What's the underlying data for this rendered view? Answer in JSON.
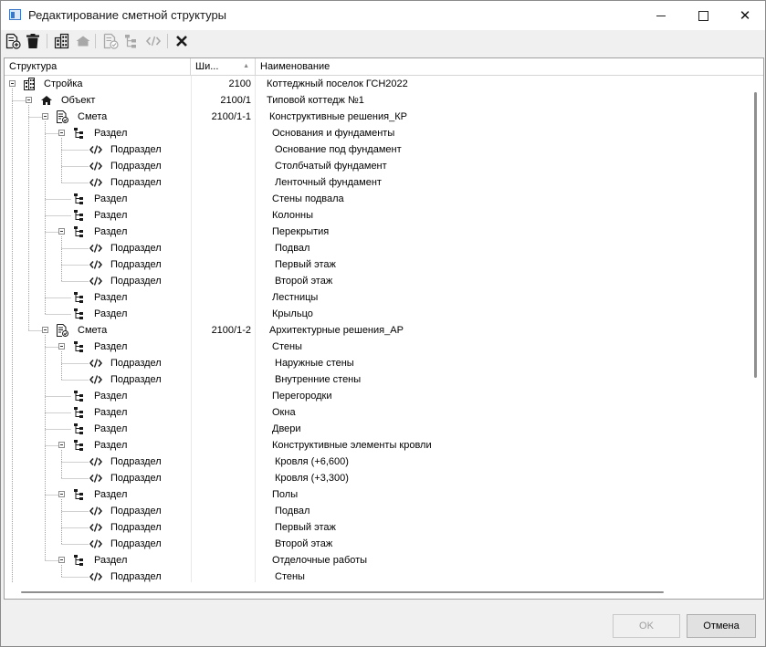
{
  "window": {
    "title": "Редактирование сметной структуры",
    "minimize_icon": "minimize-icon",
    "maximize_icon": "maximize-icon",
    "close_icon": "close-icon",
    "close_glyph": "✕"
  },
  "toolbar": {
    "buttons": [
      {
        "name": "add-item-button",
        "icon": "document-add-icon",
        "enabled": true
      },
      {
        "name": "delete-item-button",
        "icon": "trash-icon",
        "enabled": true
      },
      {
        "name": "add-construction-button",
        "icon": "building-icon",
        "enabled": true
      },
      {
        "name": "add-object-button",
        "icon": "house-icon",
        "enabled": false
      },
      {
        "name": "add-estimate-button",
        "icon": "estimate-icon",
        "enabled": false
      },
      {
        "name": "add-section-button",
        "icon": "section-tree-icon",
        "enabled": false
      },
      {
        "name": "add-subsection-button",
        "icon": "code-brackets-icon",
        "enabled": false
      },
      {
        "name": "cancel-x-button",
        "icon": "x-icon",
        "enabled": true
      }
    ]
  },
  "grid": {
    "columns": [
      {
        "label": "Структура"
      },
      {
        "label": "Ши..."
      },
      {
        "label": "Наименование"
      }
    ],
    "sort_glyph": "▲",
    "rows": [
      {
        "level": 0,
        "expander": true,
        "type": "construction",
        "label": "Стройка",
        "code": "2100",
        "name": "Коттеджный поселок ГСН2022"
      },
      {
        "level": 1,
        "expander": true,
        "type": "object",
        "label": "Объект",
        "code": "2100/1",
        "name": "Типовой коттедж №1"
      },
      {
        "level": 2,
        "expander": true,
        "type": "estimate",
        "label": "Смета",
        "code": "2100/1-1",
        "name": "Конструктивные решения_КР"
      },
      {
        "level": 3,
        "expander": true,
        "type": "section",
        "label": "Раздел",
        "code": "",
        "name": "Основания и фундаменты"
      },
      {
        "level": 4,
        "expander": false,
        "type": "subsection",
        "label": "Подраздел",
        "code": "",
        "name": "Основание под фундамент"
      },
      {
        "level": 4,
        "expander": false,
        "type": "subsection",
        "label": "Подраздел",
        "code": "",
        "name": "Столбчатый фундамент"
      },
      {
        "level": 4,
        "expander": false,
        "type": "subsection",
        "label": "Подраздел",
        "code": "",
        "name": "Ленточный фундамент"
      },
      {
        "level": 3,
        "expander": false,
        "type": "section",
        "label": "Раздел",
        "code": "",
        "name": "Стены подвала"
      },
      {
        "level": 3,
        "expander": false,
        "type": "section",
        "label": "Раздел",
        "code": "",
        "name": "Колонны"
      },
      {
        "level": 3,
        "expander": true,
        "type": "section",
        "label": "Раздел",
        "code": "",
        "name": "Перекрытия"
      },
      {
        "level": 4,
        "expander": false,
        "type": "subsection",
        "label": "Подраздел",
        "code": "",
        "name": "Подвал"
      },
      {
        "level": 4,
        "expander": false,
        "type": "subsection",
        "label": "Подраздел",
        "code": "",
        "name": "Первый этаж"
      },
      {
        "level": 4,
        "expander": false,
        "type": "subsection",
        "label": "Подраздел",
        "code": "",
        "name": "Второй этаж"
      },
      {
        "level": 3,
        "expander": false,
        "type": "section",
        "label": "Раздел",
        "code": "",
        "name": "Лестницы"
      },
      {
        "level": 3,
        "expander": false,
        "type": "section",
        "label": "Раздел",
        "code": "",
        "name": "Крыльцо"
      },
      {
        "level": 2,
        "expander": true,
        "type": "estimate",
        "label": "Смета",
        "code": "2100/1-2",
        "name": "Архитектурные решения_АР"
      },
      {
        "level": 3,
        "expander": true,
        "type": "section",
        "label": "Раздел",
        "code": "",
        "name": "Стены"
      },
      {
        "level": 4,
        "expander": false,
        "type": "subsection",
        "label": "Подраздел",
        "code": "",
        "name": "Наружные стены"
      },
      {
        "level": 4,
        "expander": false,
        "type": "subsection",
        "label": "Подраздел",
        "code": "",
        "name": "Внутренние стены"
      },
      {
        "level": 3,
        "expander": false,
        "type": "section",
        "label": "Раздел",
        "code": "",
        "name": "Перегородки"
      },
      {
        "level": 3,
        "expander": false,
        "type": "section",
        "label": "Раздел",
        "code": "",
        "name": "Окна"
      },
      {
        "level": 3,
        "expander": false,
        "type": "section",
        "label": "Раздел",
        "code": "",
        "name": "Двери"
      },
      {
        "level": 3,
        "expander": true,
        "type": "section",
        "label": "Раздел",
        "code": "",
        "name": "Конструктивные элементы кровли"
      },
      {
        "level": 4,
        "expander": false,
        "type": "subsection",
        "label": "Подраздел",
        "code": "",
        "name": "Кровля (+6,600)"
      },
      {
        "level": 4,
        "expander": false,
        "type": "subsection",
        "label": "Подраздел",
        "code": "",
        "name": "Кровля (+3,300)"
      },
      {
        "level": 3,
        "expander": true,
        "type": "section",
        "label": "Раздел",
        "code": "",
        "name": "Полы"
      },
      {
        "level": 4,
        "expander": false,
        "type": "subsection",
        "label": "Подраздел",
        "code": "",
        "name": "Подвал"
      },
      {
        "level": 4,
        "expander": false,
        "type": "subsection",
        "label": "Подраздел",
        "code": "",
        "name": "Первый этаж"
      },
      {
        "level": 4,
        "expander": false,
        "type": "subsection",
        "label": "Подраздел",
        "code": "",
        "name": "Второй этаж"
      },
      {
        "level": 3,
        "expander": true,
        "type": "section",
        "label": "Раздел",
        "code": "",
        "name": "Отделочные работы"
      },
      {
        "level": 4,
        "expander": false,
        "type": "subsection",
        "label": "Подраздел",
        "code": "",
        "name": "Стены"
      }
    ]
  },
  "footer": {
    "ok_label": "OK",
    "ok_enabled": false,
    "cancel_label": "Отмена"
  },
  "colors": {
    "tree_line": "#a0a0a0",
    "icon_dark": "#1a1a1a",
    "icon_disabled": "#a8a8a8"
  }
}
